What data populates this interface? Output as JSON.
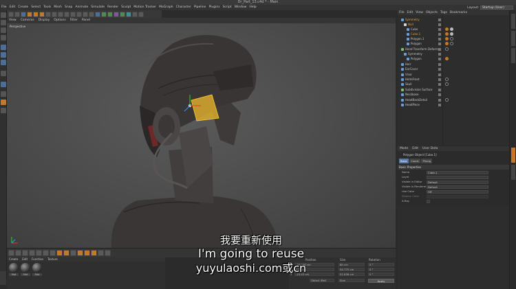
{
  "window": {
    "title": "Dr_Part_13.c4d * - Main"
  },
  "menubar": [
    "File",
    "Edit",
    "Create",
    "Select",
    "Tools",
    "Mesh",
    "Snap",
    "Animate",
    "Simulate",
    "Render",
    "Sculpt",
    "Motion Tracker",
    "MoGraph",
    "Character",
    "Pipeline",
    "Plugins",
    "Script",
    "Window",
    "Help"
  ],
  "layout": {
    "label": "Layout:",
    "value": "Startup (User)"
  },
  "viewport": {
    "menu": [
      "View",
      "Cameras",
      "Display",
      "Options",
      "Filter",
      "Panel"
    ],
    "camera_label": "Perspective"
  },
  "object_manager": {
    "menu": [
      "File",
      "Edit",
      "View",
      "Objects",
      "Tags",
      "Bookmarks"
    ],
    "rows": [
      {
        "name": "Symmetry",
        "indent": 1,
        "color": "#e2a33a"
      },
      {
        "name": "Null",
        "indent": 2,
        "color": "#e2a33a"
      },
      {
        "name": "Cube",
        "indent": 3,
        "color": "#c8c8c8"
      },
      {
        "name": "Cube.1",
        "indent": 3,
        "color": "#e2a33a"
      },
      {
        "name": "Polygon.1",
        "indent": 3,
        "color": "#c8c8c8"
      },
      {
        "name": "Polygon",
        "indent": 3,
        "color": "#c8c8c8"
      },
      {
        "name": "Hand Transform Deform",
        "indent": 1,
        "color": "#c8c8c8"
      },
      {
        "name": "Symmetry",
        "indent": 2,
        "color": "#c8c8c8"
      },
      {
        "name": "Polygon",
        "indent": 3,
        "color": "#c8c8c8"
      },
      {
        "name": "Hair",
        "indent": 1,
        "color": "#c8c8c8"
      },
      {
        "name": "EarCover",
        "indent": 1,
        "color": "#c8c8c8"
      },
      {
        "name": "Visor",
        "indent": 1,
        "color": "#c8c8c8"
      },
      {
        "name": "HelmFront",
        "indent": 1,
        "color": "#c8c8c8"
      },
      {
        "name": "Skull",
        "indent": 1,
        "color": "#c8c8c8"
      },
      {
        "name": "Subdivision Surface",
        "indent": 1,
        "color": "#c8c8c8"
      },
      {
        "name": "Neckbase",
        "indent": 1,
        "color": "#c8c8c8"
      },
      {
        "name": "HeadBackDetail",
        "indent": 1,
        "color": "#c8c8c8"
      },
      {
        "name": "HeadPiece",
        "indent": 1,
        "color": "#c8c8c8"
      }
    ]
  },
  "attribute_manager": {
    "menu": [
      "Mode",
      "Edit",
      "User Data"
    ],
    "header": "Polygon Object [Cube.1]",
    "tabs": [
      "Basic",
      "Coord.",
      "Phong"
    ],
    "section": "Basic Properties",
    "fields": [
      {
        "label": "Name",
        "value": "Cube.1"
      },
      {
        "label": "Layer",
        "value": ""
      },
      {
        "label": "Visible in Editor",
        "value": "Default"
      },
      {
        "label": "Visible in Renderer",
        "value": "Default"
      },
      {
        "label": "Use Color",
        "value": "Off"
      },
      {
        "label": "Display Color",
        "value": ""
      },
      {
        "label": "X-Ray",
        "value": ""
      }
    ]
  },
  "material_manager": {
    "menu": [
      "Create",
      "Edit",
      "Function",
      "Texture"
    ],
    "materials": [
      "Mat",
      "Mat",
      "Mat"
    ]
  },
  "coordinates": {
    "headers": [
      "Position",
      "Size",
      "Rotation"
    ],
    "rows": [
      {
        "axis": "X",
        "pos": "-23.096 cm",
        "size": "80 cm",
        "rot": "0 °"
      },
      {
        "axis": "Y",
        "pos": "37.8 cm",
        "size": "54.775 cm",
        "rot": "0 °"
      },
      {
        "axis": "Z",
        "pos": "-15.43 cm",
        "size": "51.636 cm",
        "rot": "0 °"
      }
    ],
    "mode": "Object (Rel)",
    "size_mode": "Size",
    "apply": "Apply"
  },
  "subtitles": {
    "line1": "我要重新使用",
    "line2": "I'm going to reuse",
    "line3": "yuyulaoshi.com或cn"
  }
}
